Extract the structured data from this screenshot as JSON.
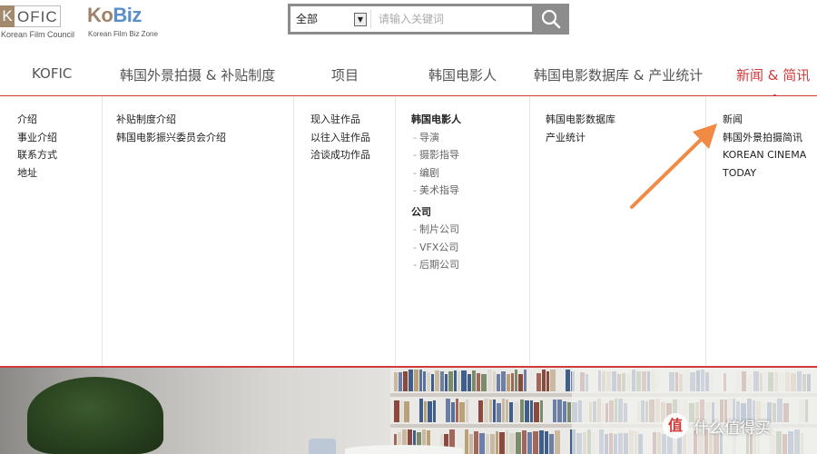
{
  "header": {
    "kofic_logo": {
      "k": "K",
      "rest": "OFIC",
      "subtitle": "Korean Film Council"
    },
    "kobiz_logo": {
      "part1": "Ko",
      "part2": "Biz",
      "subtitle": "Korean Film Biz Zone"
    },
    "search": {
      "scope_selected": "全部",
      "placeholder": "请输入关键词",
      "button_icon": "search-icon"
    }
  },
  "nav": {
    "items": [
      {
        "label": "KOFIC"
      },
      {
        "label": "韩国外景拍摄 & 补贴制度"
      },
      {
        "label": "项目"
      },
      {
        "label": "韩国电影人"
      },
      {
        "label": "韩国电影数据库 & 产业统计"
      },
      {
        "label": "新闻 & 简讯"
      }
    ],
    "active_color": "#d03a3a"
  },
  "menu": {
    "col1": [
      "介绍",
      "事业介绍",
      "联系方式",
      "地址"
    ],
    "col2": [
      "补贴制度介绍",
      "韩国电影振兴委员会介绍"
    ],
    "col3": [
      "现入驻作品",
      "以往入驻作品",
      "洽谈成功作品"
    ],
    "col4": {
      "group1_title": "韩国电影人",
      "group1_items": [
        "导演",
        "摄影指导",
        "编剧",
        "美术指导"
      ],
      "group2_title": "公司",
      "group2_items": [
        "制片公司",
        "VFX公司",
        "后期公司"
      ]
    },
    "col5": [
      "韩国电影数据库",
      "产业统计"
    ],
    "col6": [
      "新闻",
      "韩国外景拍摄简讯",
      "KOREAN CINEMA",
      "TODAY"
    ]
  },
  "watermark": {
    "icon_text": "值",
    "text": "什么值得买"
  },
  "annotation": {
    "arrow_color": "#f08a45"
  }
}
